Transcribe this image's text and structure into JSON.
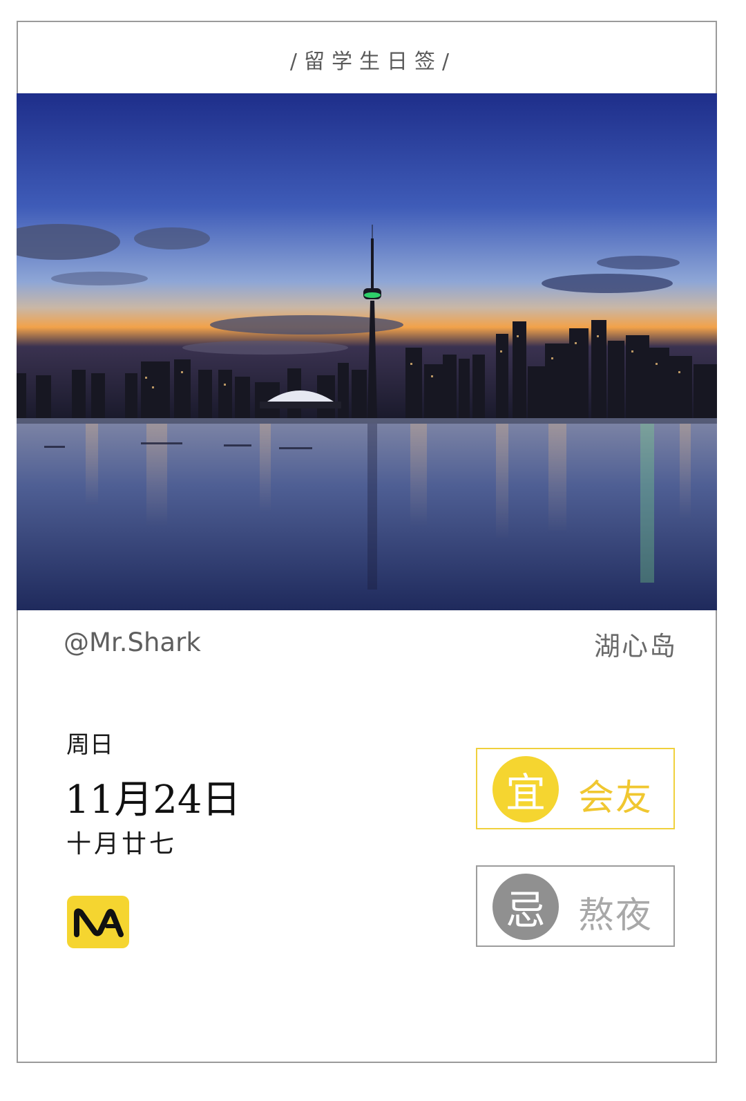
{
  "header": {
    "title": "/留学生日签/"
  },
  "photo": {
    "alt": "湖心岛"
  },
  "credit": {
    "author": "@Mr.Shark",
    "location": "湖心岛"
  },
  "date": {
    "weekday": "周日",
    "date": "11月24日",
    "lunar": "十月廿七"
  },
  "yi": {
    "badge": "宜",
    "text": "会友",
    "color": "#f5d530"
  },
  "ji": {
    "badge": "忌",
    "text": "熬夜",
    "color": "#909090"
  },
  "logo": {
    "icon": "ma-logo-icon",
    "text": "MA",
    "color": "#f5d530"
  }
}
